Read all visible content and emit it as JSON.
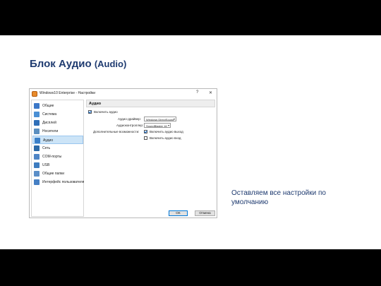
{
  "slide": {
    "title": "Блок Аудио",
    "title_suffix": "(Audio)",
    "note": "Оставляем все настройки по умолчанию"
  },
  "dialog": {
    "title": "Windows10 Enterprise - Настройки",
    "help_glyph": "?",
    "close_glyph": "✕",
    "sidebar": [
      {
        "label": "Общие",
        "icon": "general-icon",
        "color": "#3c78c8"
      },
      {
        "label": "Система",
        "icon": "system-icon",
        "color": "#4a8fd4"
      },
      {
        "label": "Дисплей",
        "icon": "display-icon",
        "color": "#2f6fb8"
      },
      {
        "label": "Носители",
        "icon": "storage-icon",
        "color": "#5b8fc0"
      },
      {
        "label": "Аудио",
        "icon": "audio-icon",
        "color": "#3a7fc8",
        "selected": true
      },
      {
        "label": "Сеть",
        "icon": "network-icon",
        "color": "#2c6aa8"
      },
      {
        "label": "COM-порты",
        "icon": "com-ports-icon",
        "color": "#4f86c6"
      },
      {
        "label": "USB",
        "icon": "usb-icon",
        "color": "#3d7cc0"
      },
      {
        "label": "Общие папки",
        "icon": "shared-folders-icon",
        "color": "#5a8ec8"
      },
      {
        "label": "Интерфейс пользователя",
        "icon": "user-interface-icon",
        "color": "#4680c4"
      }
    ],
    "panel": {
      "heading": "Аудио",
      "enable_audio_label": "Включить аудио",
      "driver_label": "Аудио-драйвер:",
      "driver_value": "Windows DirectSound",
      "controller_label": "Аудиоконтроллер:",
      "controller_value": "SoundBlaster 16",
      "extra_label": "Дополнительные возможности:",
      "enable_output_label": "Включить аудио выход",
      "enable_input_label": "Включить аудио вход"
    },
    "buttons": {
      "ok": "OK",
      "cancel": "Отмена"
    }
  }
}
